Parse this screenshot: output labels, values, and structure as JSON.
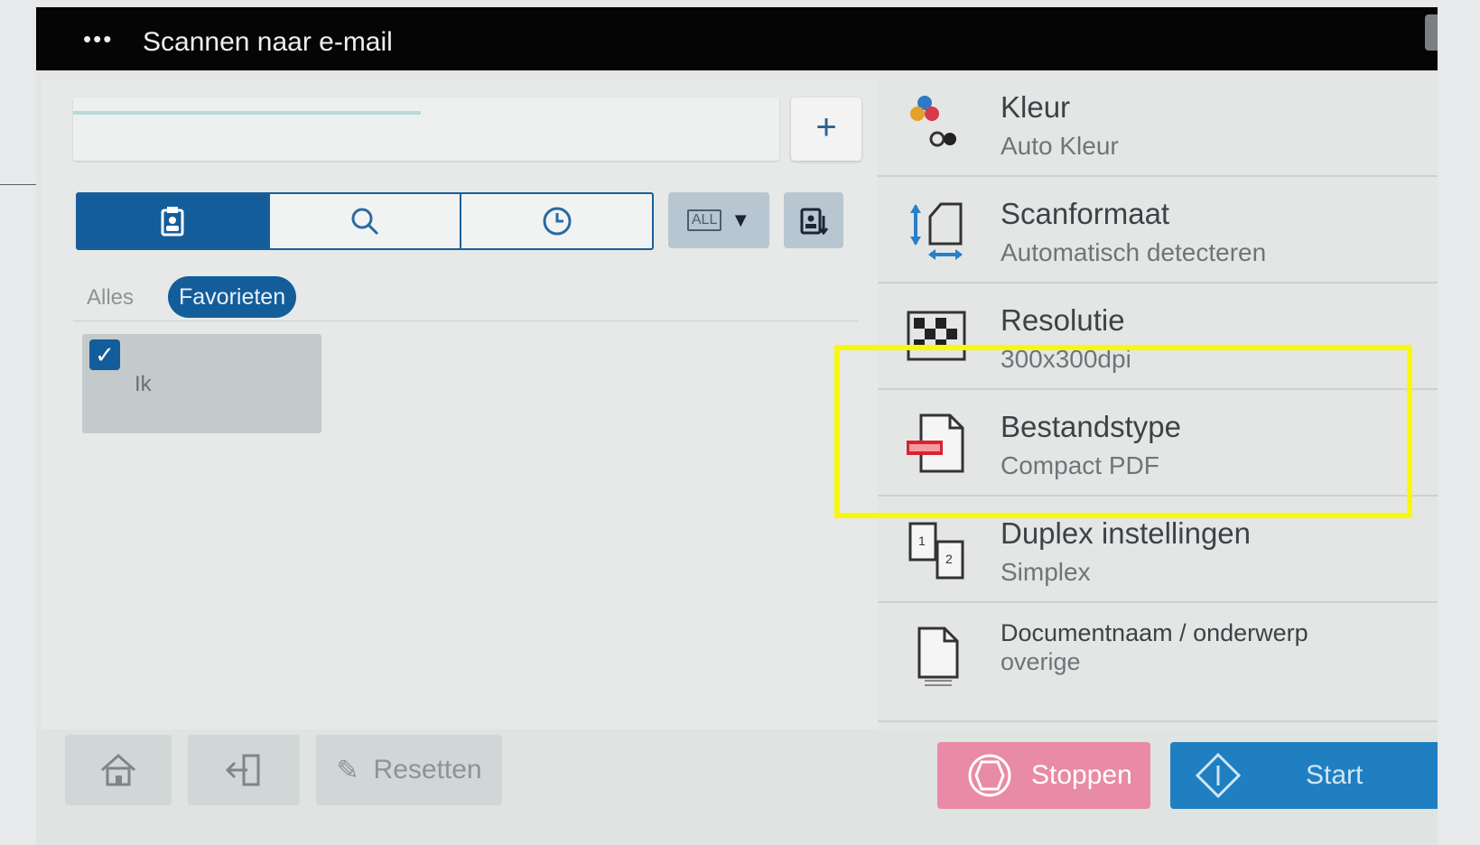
{
  "header": {
    "menu_icon": "more-icon",
    "title": "Scannen naar e-mail"
  },
  "address": {
    "value": "",
    "add_label": "+"
  },
  "tabs": [
    {
      "name": "addressbook-icon",
      "active": true
    },
    {
      "name": "search-icon",
      "active": false
    },
    {
      "name": "history-icon",
      "active": false
    }
  ],
  "index_select": {
    "tag": "ALL",
    "arrow": "▼"
  },
  "filter": {
    "all_label": "Alles",
    "favorites_label": "Favorieten"
  },
  "destinations": [
    {
      "name": "Ik",
      "checked": true
    }
  ],
  "settings": [
    {
      "label": "Kleur",
      "value": "Auto Kleur",
      "icon": "color-icon"
    },
    {
      "label": "Scanformaat",
      "value": "Automatisch detecteren",
      "icon": "scan-size-icon"
    },
    {
      "label": "Resolutie",
      "value": "300x300dpi",
      "icon": "resolution-icon"
    },
    {
      "label": "Bestandstype",
      "value": "Compact PDF",
      "icon": "pdf-file-icon"
    },
    {
      "label": "Duplex instellingen",
      "value": "Simplex",
      "icon": "duplex-icon"
    },
    {
      "label": "Documentnaam / onderwerp",
      "value": "overige",
      "icon": "document-icon"
    }
  ],
  "bottom": {
    "reset_label": "Resetten",
    "stop_label": "Stoppen",
    "start_label": "Start"
  },
  "colors": {
    "accent": "#135d9b",
    "highlight": "#f8f80a",
    "stop": "#e98aa6",
    "start": "#1f7fc1"
  }
}
